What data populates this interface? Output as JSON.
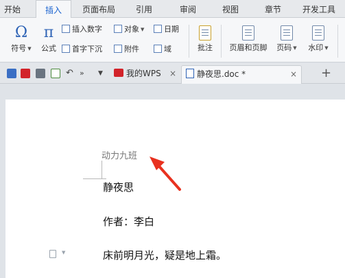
{
  "menu": {
    "tabs": [
      {
        "label": "开始",
        "active": false
      },
      {
        "label": "插入",
        "active": true
      },
      {
        "label": "页面布局",
        "active": false
      },
      {
        "label": "引用",
        "active": false
      },
      {
        "label": "审阅",
        "active": false
      },
      {
        "label": "视图",
        "active": false
      },
      {
        "label": "章节",
        "active": false
      },
      {
        "label": "开发工具",
        "active": false
      }
    ]
  },
  "ribbon": {
    "symbol": {
      "glyph": "Ω",
      "label": "符号"
    },
    "formula": {
      "glyph": "π",
      "label": "公式"
    },
    "insert_number": "插入数字",
    "first_drop_cap": "首字下沉",
    "object": "对象",
    "attachment": "附件",
    "date": "日期",
    "field": "域",
    "comment": "批注",
    "header_footer": "页眉和页脚",
    "page_number": "页码",
    "watermark": "水印"
  },
  "doc_tabs": {
    "tabs": [
      {
        "label": "我的WPS",
        "active": false
      },
      {
        "label": "静夜思.doc *",
        "active": true
      }
    ],
    "close_glyph": "×",
    "new_tab_glyph": "+"
  },
  "document": {
    "header_text": "动力九班",
    "lines": [
      "静夜思",
      "作者：李白",
      "床前明月光，疑是地上霜。"
    ]
  },
  "colors": {
    "accent": "#1c64d0",
    "wps_red": "#d2232a",
    "arrow_red": "#e8311f"
  }
}
